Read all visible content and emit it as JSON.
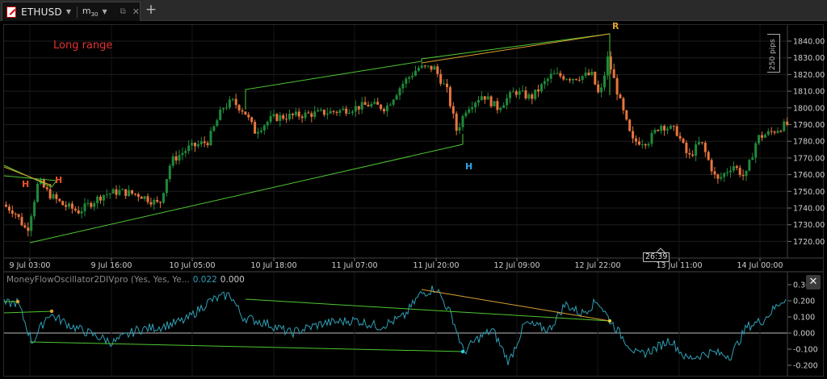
{
  "tab": {
    "symbol": "ETHUSD",
    "timeframe_main": "m",
    "timeframe_sub": "30",
    "add_label": "+"
  },
  "annotations": {
    "long_range": "Long range",
    "markers": [
      {
        "text": "H",
        "color": "#e8542b"
      },
      {
        "text": "H",
        "color": "#e8542b"
      },
      {
        "text": "H",
        "color": "#2aa3ea"
      },
      {
        "text": "R",
        "color": "#e0a030"
      }
    ]
  },
  "price_axis": {
    "labels": [
      "1840.00",
      "1830.00",
      "1820.00",
      "1810.00",
      "1800.00",
      "1790.00",
      "1780.00",
      "1770.00",
      "1760.00",
      "1750.00",
      "1740.00",
      "1730.00",
      "1720.00"
    ],
    "pips_label": "250 pips"
  },
  "time_axis": {
    "labels": [
      "9 Jul 03:00",
      "9 Jul 16:00",
      "10 Jul 05:00",
      "10 Jul 18:00",
      "11 Jul 07:00",
      "11 Jul 20:00",
      "12 Jul 09:00",
      "12 Jul 22:00",
      "13 Jul 11:00",
      "14 Jul 00:00"
    ],
    "countdown": "26:39"
  },
  "indicator": {
    "name": "MoneyFlowOscillator2DIVpro (Yes, Yes, Ye...",
    "value1": "0.022",
    "value2": "0.000",
    "axis_labels": [
      "0.300",
      "0.200",
      "0.100",
      "0.000",
      "-0.100",
      "-0.200"
    ],
    "close_label": "✕"
  },
  "colors": {
    "bull": "#1e8a3a",
    "bear": "#e8753e",
    "trendline": "#4ec733",
    "trendline_orange": "#d9a030",
    "oscillator": "#2f9fb5"
  },
  "chart_data": {
    "type": "candlestick",
    "series": [
      {
        "name": "ETHUSD",
        "ohlc_close_sample": [
          1742,
          1738,
          1728,
          1756,
          1748,
          1742,
          1736,
          1748,
          1752,
          1746,
          1744,
          1760,
          1772,
          1776,
          1780,
          1790,
          1802,
          1804,
          1786,
          1794,
          1796,
          1798,
          1800,
          1802,
          1798,
          1806,
          1812,
          1822,
          1826,
          1822,
          1800,
          1792,
          1806,
          1812,
          1804,
          1806,
          1810,
          1816,
          1822,
          1820,
          1818,
          1822,
          1812,
          1806,
          1830,
          1814,
          1788,
          1782,
          1786,
          1788,
          1780,
          1768,
          1776,
          1770,
          1756,
          1762,
          1770,
          1776,
          1786,
          1788,
          1786
        ]
      }
    ],
    "ylim": [
      1715,
      1845
    ],
    "oscillator_ylim": [
      -0.22,
      0.32
    ]
  }
}
